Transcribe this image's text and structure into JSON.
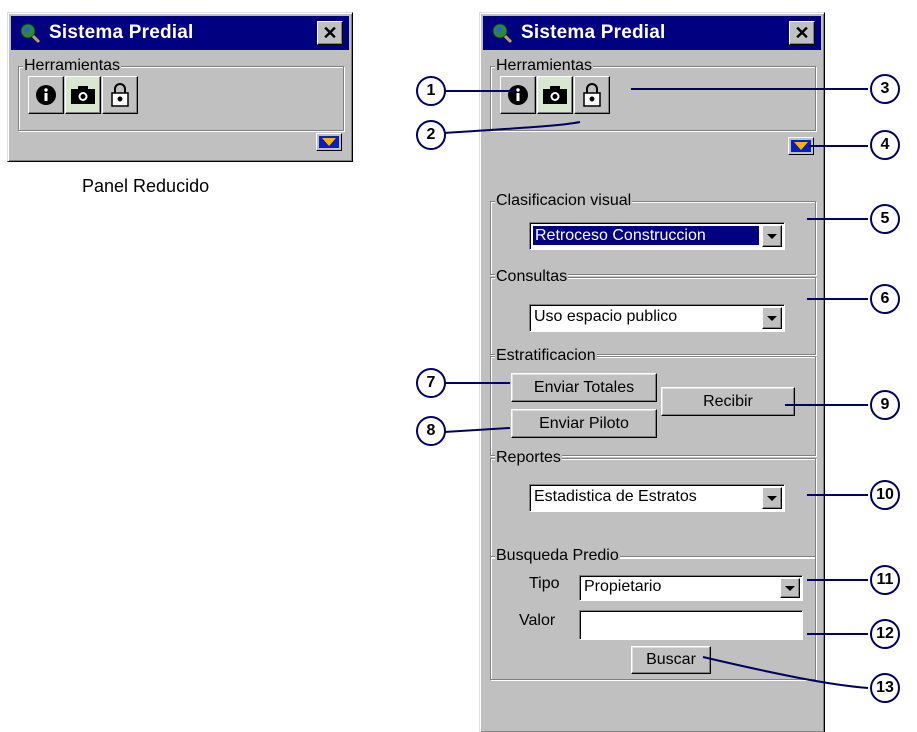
{
  "window_title": "Sistema Predial",
  "close_glyph": "✕",
  "small_panel": {
    "group_label": "Herramientas",
    "caption": "Panel Reducido"
  },
  "tools": [
    "info-icon",
    "camera-icon",
    "lock-icon"
  ],
  "clasificacion": {
    "label": "Clasificacion visual",
    "value": "Retroceso Construccion"
  },
  "consultas": {
    "label": "Consultas",
    "value": "Uso espacio publico"
  },
  "estratificacion": {
    "label": "Estratificacion",
    "enviar_totales": "Enviar Totales",
    "enviar_piloto": "Enviar Piloto",
    "recibir": "Recibir"
  },
  "reportes": {
    "label": "Reportes",
    "value": "Estadistica de Estratos"
  },
  "busqueda": {
    "label": "Busqueda Predio",
    "tipo_label": "Tipo",
    "tipo_value": "Propietario",
    "valor_label": "Valor",
    "valor_value": "",
    "buscar": "Buscar"
  },
  "callouts": [
    "1",
    "2",
    "3",
    "4",
    "5",
    "6",
    "7",
    "8",
    "9",
    "10",
    "11",
    "12",
    "13"
  ],
  "colors": {
    "titlebar": "#000080",
    "face": "#c0c0c0",
    "callout_border": "#000060"
  }
}
